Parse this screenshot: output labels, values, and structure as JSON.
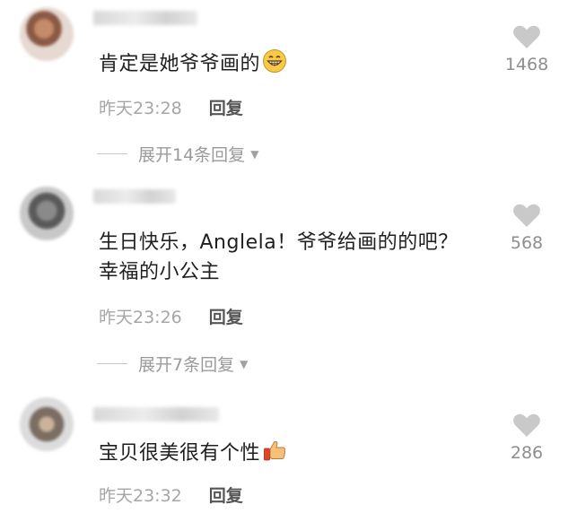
{
  "comments": [
    {
      "text": "肯定是她爷爷画的",
      "emoji": "grinning-emoji",
      "time": "昨天23:28",
      "reply_label": "回复",
      "likes": "1468",
      "expand_label": "展开14条回复"
    },
    {
      "text": "生日快乐，Anglela！爷爷给画的的吧？幸福的小公主",
      "time": "昨天23:26",
      "reply_label": "回复",
      "likes": "568",
      "expand_label": "展开7条回复"
    },
    {
      "text": "宝贝很美很有个性",
      "emoji": "thumbs-up-emoji",
      "time": "昨天23:32",
      "reply_label": "回复",
      "likes": "286"
    }
  ],
  "colors": {
    "text": "#1f1f1f",
    "meta": "#a6a6a6",
    "heart": "#c9c9c9"
  }
}
